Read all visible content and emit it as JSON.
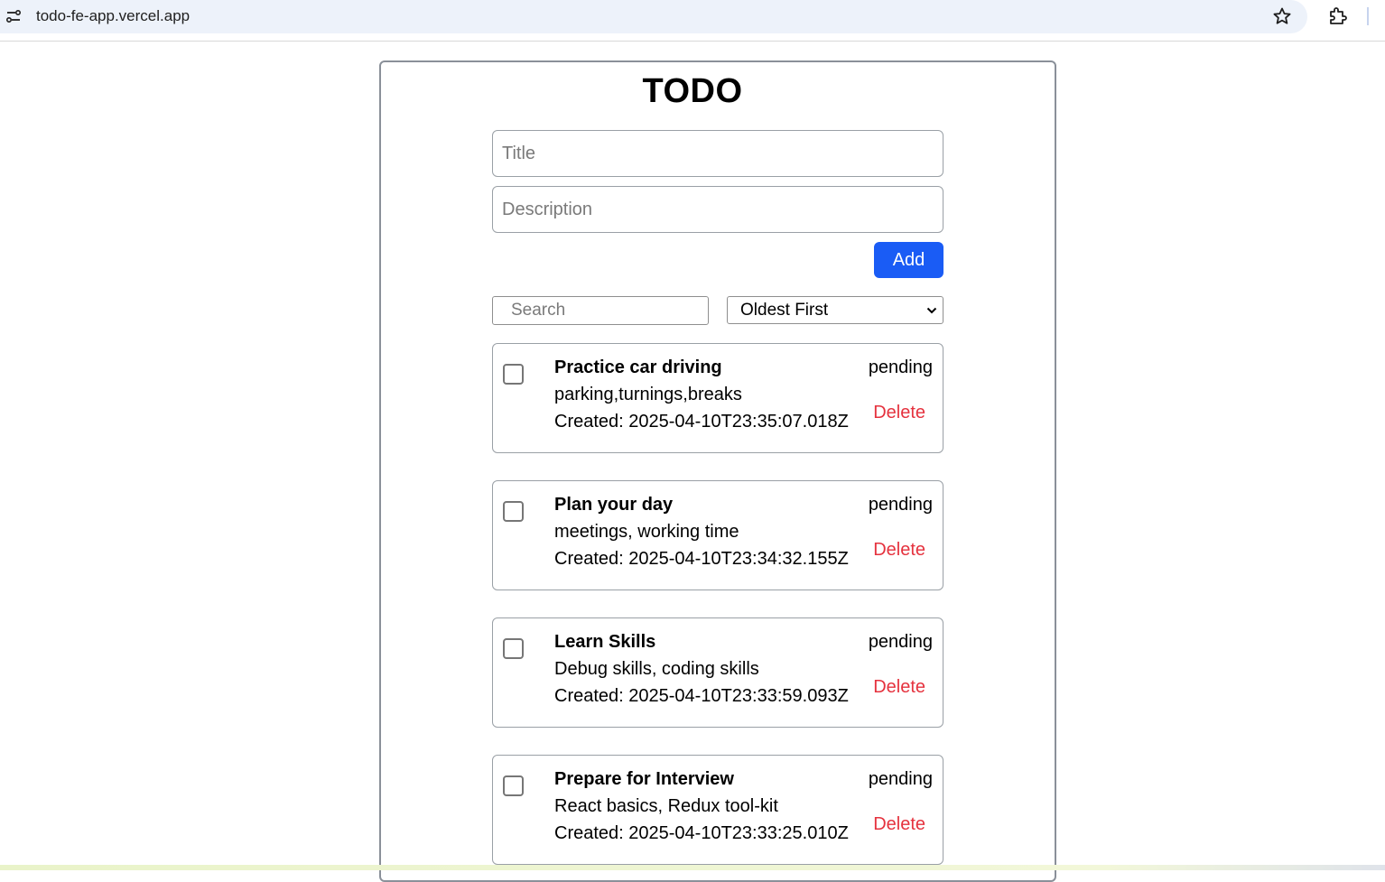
{
  "browser": {
    "url": "todo-fe-app.vercel.app",
    "icons": [
      "site-info-icon",
      "bookmark-star-icon",
      "extensions-icon"
    ]
  },
  "app": {
    "title": "TODO",
    "title_placeholder": "Title",
    "description_placeholder": "Description",
    "add_label": "Add",
    "search_placeholder": "Search",
    "sort_selected": "Oldest First",
    "todos": [
      {
        "title": "Practice car driving",
        "description": "parking,turnings,breaks",
        "created": "Created: 2025-04-10T23:35:07.018Z",
        "status": "pending",
        "delete_label": "Delete"
      },
      {
        "title": "Plan your day",
        "description": "meetings, working time",
        "created": "Created: 2025-04-10T23:34:32.155Z",
        "status": "pending",
        "delete_label": "Delete"
      },
      {
        "title": "Learn Skills",
        "description": "Debug skills, coding skills",
        "created": "Created: 2025-04-10T23:33:59.093Z",
        "status": "pending",
        "delete_label": "Delete"
      },
      {
        "title": "Prepare for Interview",
        "description": "React basics, Redux tool-kit",
        "created": "Created: 2025-04-10T23:33:25.010Z",
        "status": "pending",
        "delete_label": "Delete"
      }
    ]
  },
  "colors": {
    "accent": "#1a5cf5",
    "delete": "#e5323e"
  }
}
